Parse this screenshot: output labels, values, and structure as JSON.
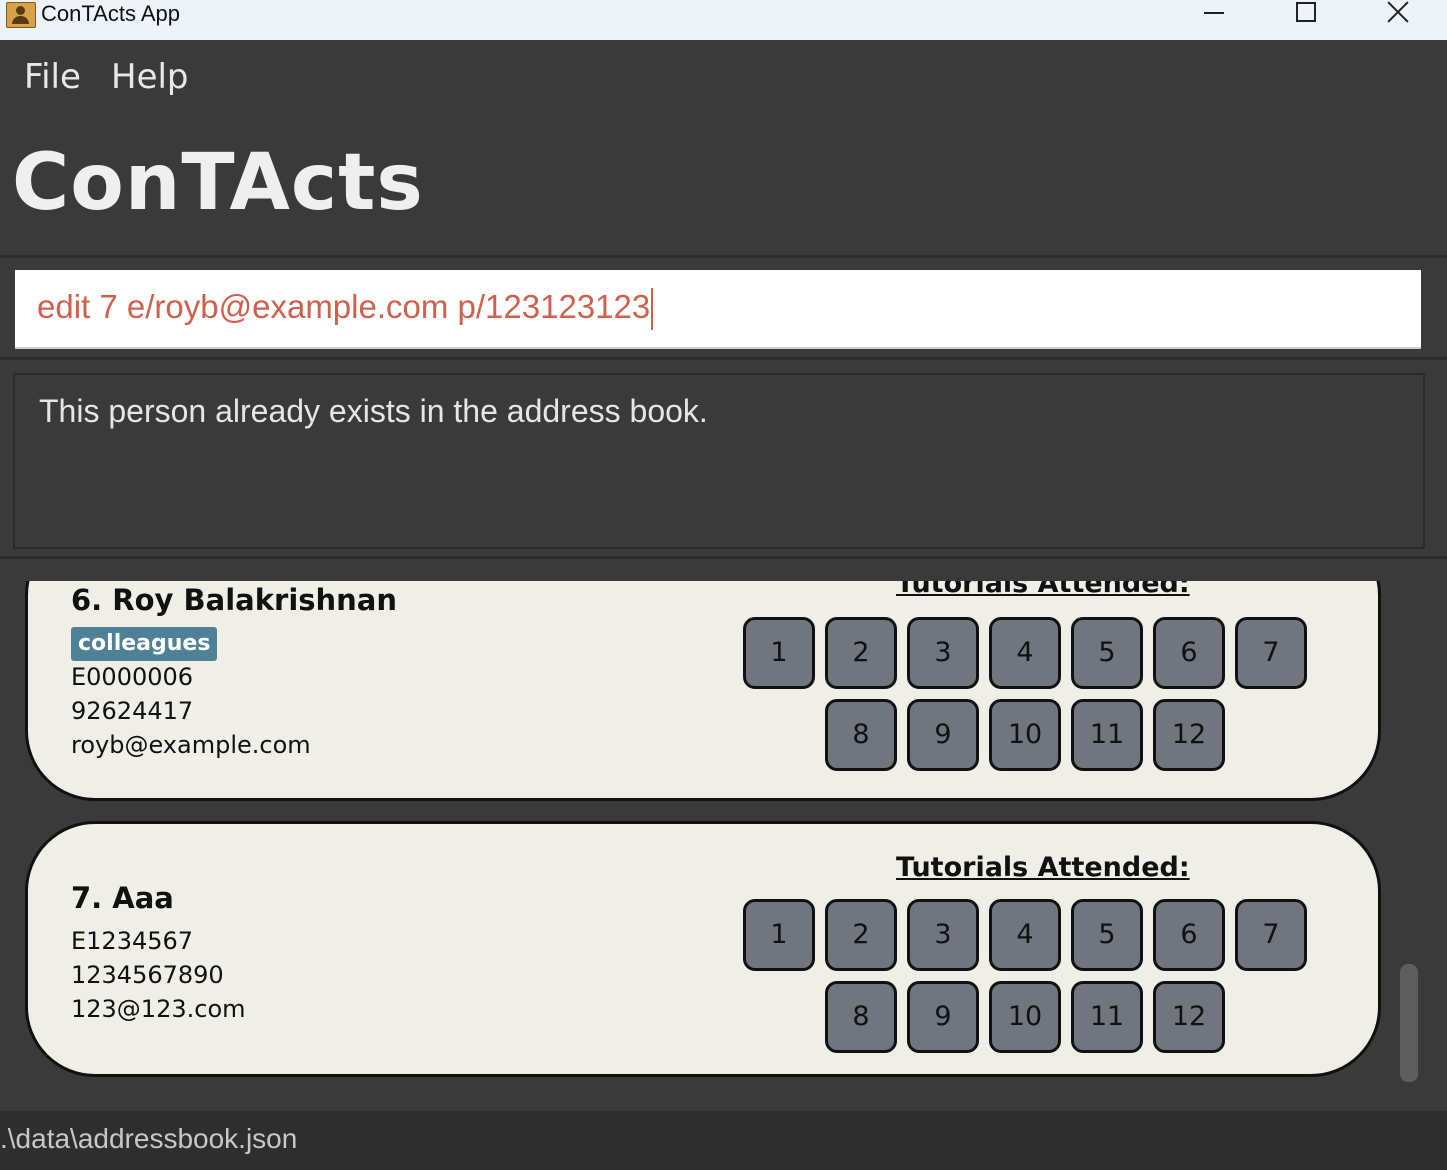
{
  "window": {
    "title": "ConTActs App"
  },
  "menu": {
    "file": "File",
    "help": "Help"
  },
  "app": {
    "heading": "ConTActs"
  },
  "command": {
    "value": "edit 7 e/royb@example.com p/123123123"
  },
  "result": {
    "message": "This person already exists in the address book."
  },
  "tutorials_label": "Tutorials Attended:",
  "persons": [
    {
      "name": "6. Roy Balakrishnan",
      "tag": "colleagues",
      "id": "E0000006",
      "phone": "92624417",
      "email": "royb@example.com",
      "tutorials": [
        "1",
        "2",
        "3",
        "4",
        "5",
        "6",
        "7",
        "8",
        "9",
        "10",
        "11",
        "12"
      ]
    },
    {
      "name": "7. Aaa",
      "id": "E1234567",
      "phone": "1234567890",
      "email": "123@123.com",
      "tutorials": [
        "1",
        "2",
        "3",
        "4",
        "5",
        "6",
        "7",
        "8",
        "9",
        "10",
        "11",
        "12"
      ]
    }
  ],
  "status": {
    "path": ".\\data\\addressbook.json"
  },
  "colors": {
    "tag": "#4e8196",
    "card_bg": "#efefe7",
    "command_text": "#d0604e",
    "tutorial_btn": "#70757e"
  }
}
